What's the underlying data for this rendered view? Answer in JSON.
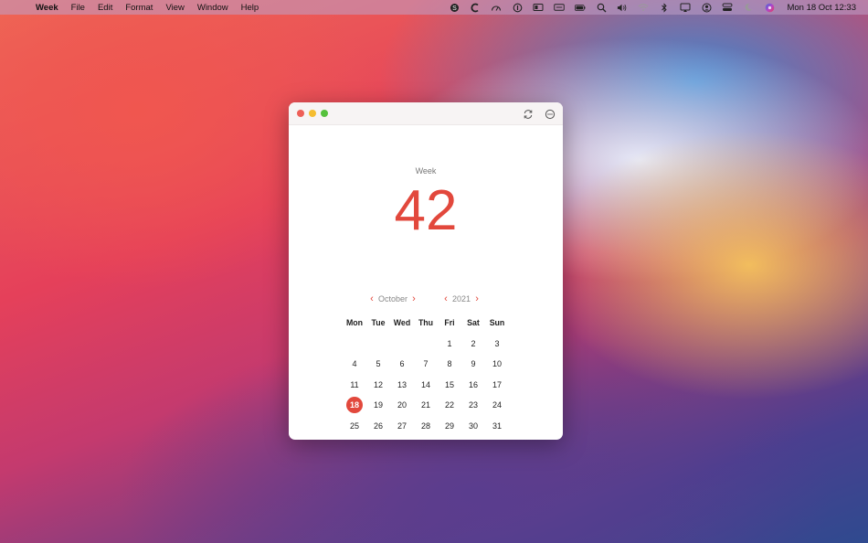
{
  "menubar": {
    "apple_icon": "",
    "app_name": "Week",
    "items": [
      "File",
      "Edit",
      "Format",
      "View",
      "Window",
      "Help"
    ],
    "status_icons": [
      "skype-icon",
      "cleanmymac-icon",
      "speedometer-icon",
      "onepassword-icon",
      "display-icon",
      "keyboard-icon",
      "battery-icon",
      "search-icon",
      "volume-icon",
      "wifi-icon",
      "bluetooth-icon",
      "airplay-icon",
      "user-icon",
      "control-center-icon",
      "do-not-disturb-icon",
      "siri-icon"
    ],
    "clock": "Mon 18 Oct  12:33"
  },
  "window": {
    "week_label": "Week",
    "week_number": "42",
    "month": "October",
    "year": "2021",
    "accent_color": "#e2483c"
  },
  "calendar": {
    "weekdays": [
      "Mon",
      "Tue",
      "Wed",
      "Thu",
      "Fri",
      "Sat",
      "Sun"
    ],
    "weeks": [
      [
        "",
        "",
        "",
        "",
        "1",
        "2",
        "3"
      ],
      [
        "4",
        "5",
        "6",
        "7",
        "8",
        "9",
        "10"
      ],
      [
        "11",
        "12",
        "13",
        "14",
        "15",
        "16",
        "17"
      ],
      [
        "18",
        "19",
        "20",
        "21",
        "22",
        "23",
        "24"
      ],
      [
        "25",
        "26",
        "27",
        "28",
        "29",
        "30",
        "31"
      ]
    ],
    "today": "18"
  }
}
